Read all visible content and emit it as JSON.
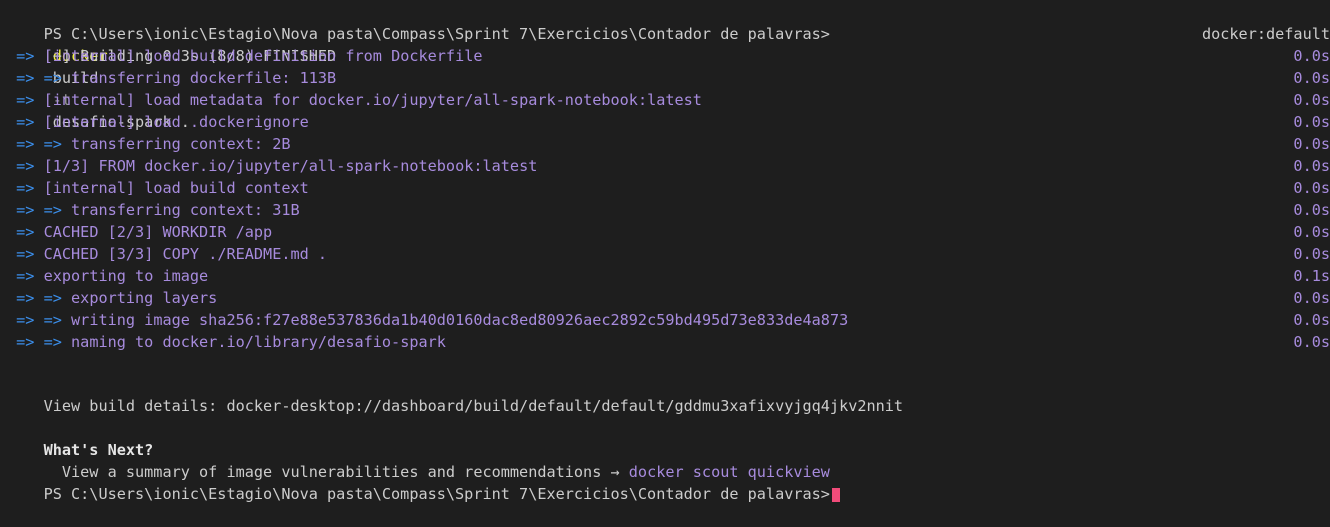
{
  "prompt": {
    "path": "PS C:\\Users\\ionic\\Estagio\\Nova pasta\\Compass\\Sprint 7\\Exercicios\\Contador de palavras>",
    "command": "docker",
    "args_before_flag": "build",
    "flag": "-t",
    "args_after_flag": "desafio-spark ."
  },
  "build_header": {
    "text": "[+] Building 0.3s (8/8) FINISHED",
    "context": "docker:default"
  },
  "steps": [
    {
      "arrow": "=>",
      "text": "[internal] load build definition from Dockerfile",
      "time": "0.0s"
    },
    {
      "arrow": "=> =>",
      "text": "transferring dockerfile: 113B",
      "time": "0.0s"
    },
    {
      "arrow": "=>",
      "text": "[internal] load metadata for docker.io/jupyter/all-spark-notebook:latest",
      "time": "0.0s"
    },
    {
      "arrow": "=>",
      "text": "[internal] load .dockerignore",
      "time": "0.0s"
    },
    {
      "arrow": "=> =>",
      "text": "transferring context: 2B",
      "time": "0.0s"
    },
    {
      "arrow": "=>",
      "text": "[1/3] FROM docker.io/jupyter/all-spark-notebook:latest",
      "time": "0.0s"
    },
    {
      "arrow": "=>",
      "text": "[internal] load build context",
      "time": "0.0s"
    },
    {
      "arrow": "=> =>",
      "text": "transferring context: 31B",
      "time": "0.0s"
    },
    {
      "arrow": "=>",
      "text": "CACHED [2/3] WORKDIR /app",
      "time": "0.0s"
    },
    {
      "arrow": "=>",
      "text": "CACHED [3/3] COPY ./README.md .",
      "time": "0.0s"
    },
    {
      "arrow": "=>",
      "text": "exporting to image",
      "time": "0.1s"
    },
    {
      "arrow": "=> =>",
      "text": "exporting layers",
      "time": "0.0s"
    },
    {
      "arrow": "=> =>",
      "text": "writing image sha256:f27e88e537836da1b40d0160dac8ed80926aec2892c59bd495d73e833de4a873",
      "time": "0.0s"
    },
    {
      "arrow": "=> =>",
      "text": "naming to docker.io/library/desafio-spark",
      "time": "0.0s"
    }
  ],
  "build_details": "View build details: docker-desktop://dashboard/build/default/default/gddmu3xafixvyjgq4jkv2nnit",
  "whats_next": {
    "title": "What's Next?",
    "hint": "  View a summary of image vulnerabilities and recommendations → ",
    "command": "docker scout quickview"
  },
  "final_prompt": "PS C:\\Users\\ionic\\Estagio\\Nova pasta\\Compass\\Sprint 7\\Exercicios\\Contador de palavras>",
  "colors": {
    "background": "#1e1e1e",
    "foreground": "#cccccc",
    "arrow": "#3b8eea",
    "step": "#a78bdd",
    "command": "#f5f543",
    "cursor": "#f14c7a"
  }
}
